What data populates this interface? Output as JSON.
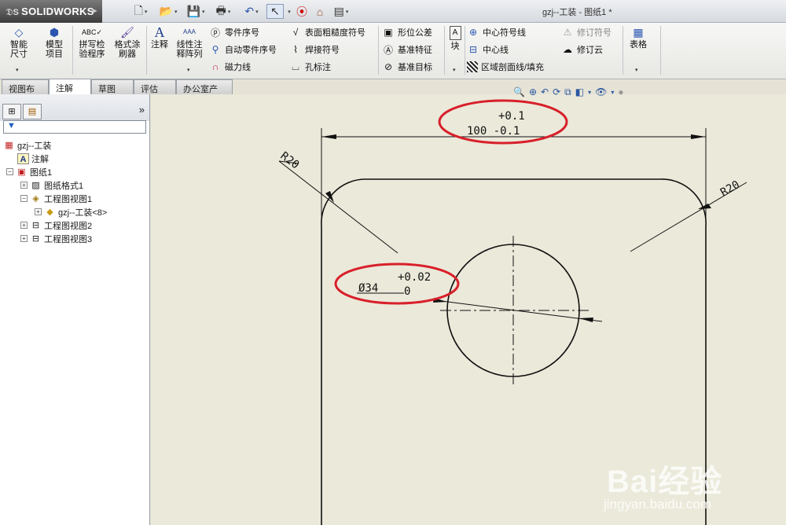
{
  "app": {
    "brand": "SOLIDWORKS",
    "document_title": "gzj--工装 - 图纸1 *"
  },
  "ribbon": {
    "smart_dimension": "智能尺寸",
    "model_items": "模型项目",
    "spell_check": "拼写检验程序",
    "format_painter": "格式涂刷器",
    "note": "注释",
    "linear_note_pattern": "线性注释阵列",
    "balloon": "零件序号",
    "auto_balloon": "自动零件序号",
    "magnetic_line": "磁力线",
    "surface_finish": "表面粗糙度符号",
    "weld_symbol": "焊接符号",
    "hole_callout": "孔标注",
    "geometric_tolerance": "形位公差",
    "datum_feature": "基准特征",
    "datum_target": "基准目标",
    "block": "块",
    "centermark": "中心符号线",
    "centerline": "中心线",
    "area_hatch": "区域剖面线/填充",
    "revision_symbol": "修订符号",
    "revision_cloud": "修订云",
    "table": "表格"
  },
  "tabs": [
    "视图布局",
    "注解",
    "草图",
    "评估",
    "办公室产品"
  ],
  "active_tab": "注解",
  "tree": {
    "root": "gzj--工装",
    "annotations": "注解",
    "sheet": "图纸1",
    "sheet_format": "图纸格式1",
    "view1": "工程图视图1",
    "part": "gzj--工装<8>",
    "view2": "工程图视图2",
    "view3": "工程图视图3"
  },
  "drawing": {
    "width_tol_upper": "+0.1",
    "width_dim": "100 -0.1",
    "left_radius": "R20",
    "right_radius": "R20",
    "hole_tol_upper": "+0.02",
    "hole_dim": "Ø34",
    "hole_tol_lower": "0"
  },
  "watermark": {
    "brand": "Bai经验",
    "url": "jingyan.baidu.com"
  },
  "colors": {
    "highlight_ellipse": "#d8202a",
    "canvas_bg": "#ebe9da",
    "tab_active": "#ffffff"
  }
}
